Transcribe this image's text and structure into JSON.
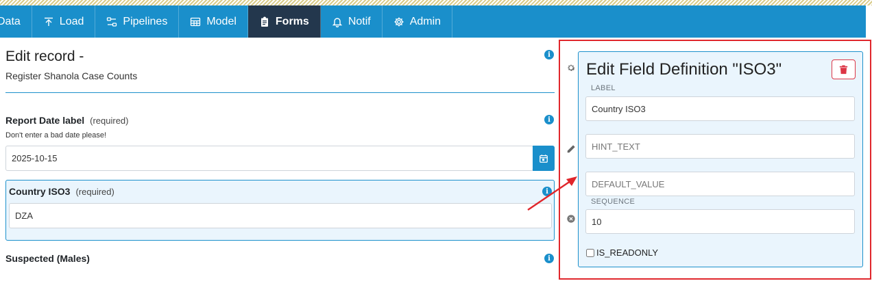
{
  "nav": {
    "items": [
      {
        "label": "Data",
        "icon": "none"
      },
      {
        "label": "Load",
        "icon": "upload-icon"
      },
      {
        "label": "Pipelines",
        "icon": "pipeline-icon"
      },
      {
        "label": "Model",
        "icon": "table-icon"
      },
      {
        "label": "Forms",
        "icon": "clipboard-icon",
        "active": true
      },
      {
        "label": "Notif",
        "icon": "bell-icon"
      },
      {
        "label": "Admin",
        "icon": "gear-icon"
      }
    ]
  },
  "form": {
    "title": "Edit record -",
    "subtitle": "Register Shanola Case Counts",
    "fields": {
      "report_date": {
        "label": "Report Date label",
        "required": "(required)",
        "hint": "Don't enter a bad date please!",
        "value": "2025-10-15"
      },
      "country": {
        "label": "Country ISO3",
        "required": "(required)",
        "value": "DZA"
      },
      "suspected": {
        "label": "Suspected (Males)"
      }
    }
  },
  "editor": {
    "title": "Edit Field Definition \"ISO3\"",
    "label_caption": "LABEL",
    "label_value": "Country ISO3",
    "hint_placeholder": "HINT_TEXT",
    "default_placeholder": "DEFAULT_VALUE",
    "sequence_caption": "SEQUENCE",
    "sequence_value": "10",
    "readonly_label": "IS_READONLY"
  },
  "colors": {
    "accent": "#1a8fcb",
    "active_nav": "#23374d",
    "highlight": "#e0262b",
    "danger": "#dc3545"
  }
}
